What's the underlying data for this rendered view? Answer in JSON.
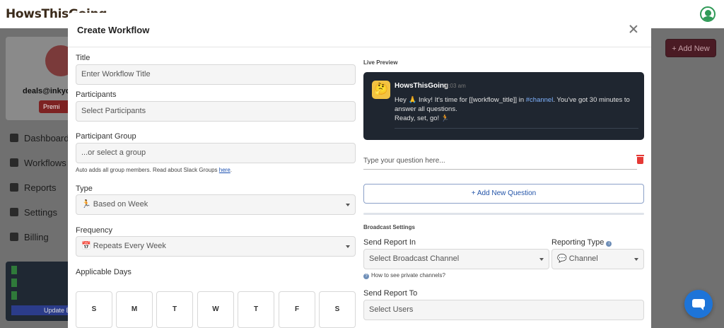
{
  "app": {
    "brand": "HowsThisGoing",
    "email": "deals@inkyd",
    "premium_label": "Premi",
    "nav": [
      {
        "label": "Dashboard"
      },
      {
        "label": "Workflows"
      },
      {
        "label": "Reports"
      },
      {
        "label": "Settings"
      },
      {
        "label": "Billing"
      }
    ],
    "checklist_button": "Update B",
    "add_new_label": "+ Add New"
  },
  "modal": {
    "title": "Create Workflow",
    "left": {
      "title_label": "Title",
      "title_placeholder": "Enter Workflow Title",
      "participants_label": "Participants",
      "participants_placeholder": "Select Participants",
      "group_label": "Participant Group",
      "group_placeholder": "...or select a group",
      "group_help_text": "Auto adds all group members. Read about Slack Groups ",
      "group_help_link": "here",
      "group_help_end": ".",
      "type_label": "Type",
      "type_icon": "🏃",
      "type_value": "Based on Week",
      "frequency_label": "Frequency",
      "frequency_icon": "📅",
      "frequency_value": "Repeats Every Week",
      "days_label": "Applicable Days",
      "days": [
        "S",
        "M",
        "T",
        "W",
        "T",
        "F",
        "S"
      ]
    },
    "right": {
      "live_preview_label": "Live Preview",
      "bot_name": "HowsThisGoing",
      "bot_time": "11:03 am",
      "bot_avatar": "🤔",
      "message_part1": "Hey 🙏 Inky! It's time for [[workflow_title]] in ",
      "message_channel": "#channel",
      "message_part2": ". You've got 30 minutes to answer all questions.",
      "message_line2": "Ready, set, go! 🏃",
      "question_placeholder": "Type your question here...",
      "add_question_label": "+ Add New Question",
      "broadcast_settings_label": "Broadcast Settings",
      "send_report_in_label": "Send Report In",
      "broadcast_channel_placeholder": "Select Broadcast Channel",
      "private_channels_help": "How to see private channels?",
      "reporting_type_label": "Reporting Type",
      "reporting_type_icon": "💬",
      "reporting_type_value": "Channel",
      "send_report_to_label": "Send Report To",
      "select_users_placeholder": "Select Users"
    }
  }
}
